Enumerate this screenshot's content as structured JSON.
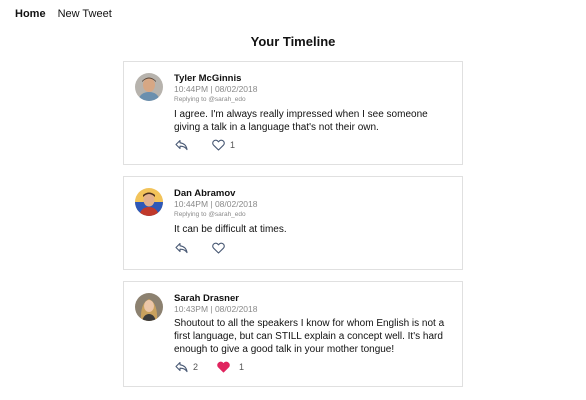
{
  "nav": {
    "home": "Home",
    "new_tweet": "New Tweet"
  },
  "page_title": "Your Timeline",
  "colors": {
    "liked": "#e0245e",
    "icon": "#4a5a75"
  },
  "tweets": [
    {
      "author": "Tyler McGinnis",
      "meta": "10:44PM | 08/02/2018",
      "replying": "Replying to @sarah_edo",
      "text": "I agree. I'm always really impressed when I see someone giving a talk in a language that's not their own.",
      "reply_count": "",
      "like_count": "1",
      "liked": false,
      "avatar_icon": "avatar-tyler"
    },
    {
      "author": "Dan Abramov",
      "meta": "10:44PM | 08/02/2018",
      "replying": "Replying to @sarah_edo",
      "text": "It can be difficult at times.",
      "reply_count": "",
      "like_count": "",
      "liked": false,
      "avatar_icon": "avatar-dan"
    },
    {
      "author": "Sarah Drasner",
      "meta": "10:43PM | 08/02/2018",
      "replying": "",
      "text": "Shoutout to all the speakers I know for whom English is not a first language, but can STILL explain a concept well. It's hard enough to give a good talk in your mother tongue!",
      "reply_count": "2",
      "like_count": "1",
      "liked": true,
      "avatar_icon": "avatar-sarah"
    }
  ]
}
